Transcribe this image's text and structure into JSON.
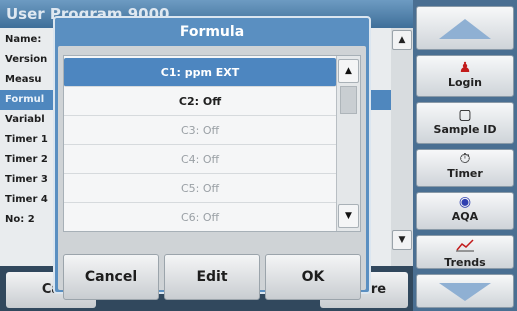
{
  "background": {
    "title": "User Program  9000",
    "rows": [
      {
        "label": "Name:"
      },
      {
        "label": "Version"
      },
      {
        "label": "Measu"
      },
      {
        "label": "Formul"
      },
      {
        "label": "Variabl"
      },
      {
        "label": "Timer 1"
      },
      {
        "label": "Timer 2"
      },
      {
        "label": "Timer 3"
      },
      {
        "label": "Timer 4"
      },
      {
        "label": "No: 2"
      }
    ],
    "bottom_left": "Ca",
    "bottom_right": "ore"
  },
  "sidebar": {
    "up_icon": "up-arrow-icon",
    "login": "Login",
    "sample_id": "Sample ID",
    "timer": "Timer",
    "aqa": "AQA",
    "trends": "Trends",
    "down_icon": "down-arrow-icon"
  },
  "dialog": {
    "title": "Formula",
    "items": [
      {
        "label": "C1: ppm EXT"
      },
      {
        "label": "C2: Off"
      },
      {
        "label": "C3: Off"
      },
      {
        "label": "C4: Off"
      },
      {
        "label": "C5: Off"
      },
      {
        "label": "C6: Off"
      }
    ],
    "buttons": {
      "cancel": "Cancel",
      "edit": "Edit",
      "ok": "OK"
    }
  }
}
